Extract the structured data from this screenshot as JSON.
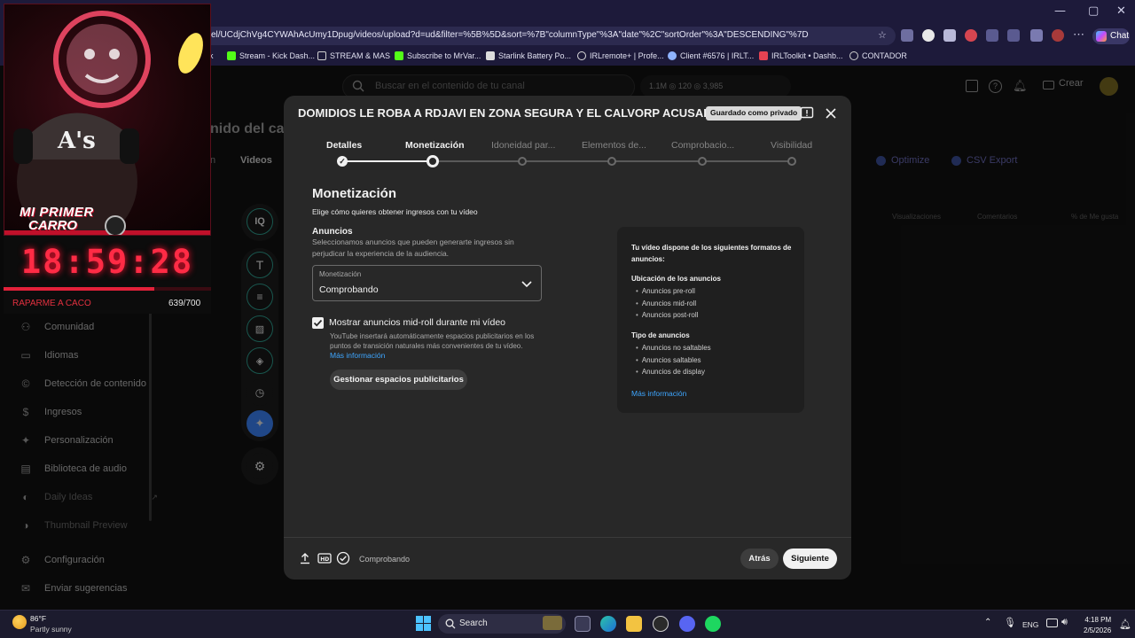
{
  "browser": {
    "url": "el/UCdjChVg4CYWAhAcUmy1Dpug/videos/upload?d=ud&filter=%5B%5D&sort=%7B\"columnType\"%3A\"date\"%2C\"sortOrder\"%3A\"DESCENDING\"%7D",
    "chat_label": "Chat",
    "window_controls": [
      "—",
      "▢",
      "✕"
    ],
    "bookmarks": [
      {
        "label": "k",
        "color": "#53fc18"
      },
      {
        "label": "Stream - Kick Dash...",
        "color": "#53fc18"
      },
      {
        "label": "STREAM & MAS",
        "color": "#cfcfcf"
      },
      {
        "label": "Subscribe to MrVar...",
        "color": "#53fc18"
      },
      {
        "label": "Starlink Battery Po...",
        "color": "#dcdcdc"
      },
      {
        "label": "IRLremote+ | Profe...",
        "color": "#dcdcdc"
      },
      {
        "label": "Client #6576 | IRLT...",
        "color": "#8fb3ff"
      },
      {
        "label": "IRLToolkit • Dashb...",
        "color": "#e34252"
      },
      {
        "label": "CONTADOR",
        "color": "#cfcfcf"
      }
    ]
  },
  "studio": {
    "search_placeholder": "Buscar en el contenido de tu canal",
    "stats": "1.1M  ◎ 120  ◎ 3,985",
    "create_label": "Crear",
    "page_title": "nido del can",
    "tabs": [
      "n",
      "Videos"
    ],
    "right_actions": [
      "Optimize",
      "CSV Export"
    ],
    "columns": [
      "Visualizaciones",
      "Comentarios",
      "% de Me gusta"
    ],
    "sidebar": [
      {
        "label": "Comunidad",
        "icon": "people-icon",
        "glyph": "⚇",
        "dim": false
      },
      {
        "label": "Idiomas",
        "icon": "subtitles-icon",
        "glyph": "▭",
        "dim": false
      },
      {
        "label": "Detección de contenido",
        "icon": "copyright-icon",
        "glyph": "©",
        "dim": false
      },
      {
        "label": "Ingresos",
        "icon": "dollar-icon",
        "glyph": "$",
        "dim": false
      },
      {
        "label": "Personalización",
        "icon": "magic-wand-icon",
        "glyph": "✦",
        "dim": false
      },
      {
        "label": "Biblioteca de audio",
        "icon": "audio-library-icon",
        "glyph": "▤",
        "dim": false
      },
      {
        "label": "Daily Ideas",
        "icon": "ideas-icon",
        "glyph": "◐",
        "dim": true
      },
      {
        "label": "Thumbnail Preview",
        "icon": "preview-icon",
        "glyph": "◑",
        "dim": true
      },
      {
        "label": "Configuración",
        "icon": "gear-icon",
        "glyph": "⚙",
        "dim": false
      },
      {
        "label": "Enviar sugerencias",
        "icon": "feedback-icon",
        "glyph": "✉",
        "dim": false
      }
    ]
  },
  "webcam": {
    "title_line1": "MI PRIMER",
    "title_line2": "CARRO",
    "clock": "18:59:28",
    "goal_label": "RAPARME A CACO",
    "goal_count": "639/700",
    "goal_progress": 0.913
  },
  "modal": {
    "title": "DOMIDIOS LE ROBA A RDJAVI EN ZONA SEGURA Y EL CALVORP ACUSAD...",
    "saved_badge": "Guardado como privado",
    "steps": [
      {
        "label": "Detalles",
        "state": "done"
      },
      {
        "label": "Monetización",
        "state": "current"
      },
      {
        "label": "Idoneidad par...",
        "state": "pending"
      },
      {
        "label": "Elementos de...",
        "state": "pending"
      },
      {
        "label": "Comprobacio...",
        "state": "pending"
      },
      {
        "label": "Visibilidad",
        "state": "pending"
      }
    ],
    "heading": "Monetización",
    "subheading": "Elige cómo quieres obtener ingresos con tu vídeo",
    "ads_heading": "Anuncios",
    "ads_description": "Seleccionamos anuncios que pueden generarte ingresos sin perjudicar la experiencia de la audiencia.",
    "select_label": "Monetización",
    "select_value": "Comprobando",
    "midroll_checked": true,
    "midroll_label": "Mostrar anuncios mid-roll durante mi vídeo",
    "midroll_description": "YouTube insertará automáticamente espacios publicitarios en los puntos de transición naturales más convenientes de tu vídeo.",
    "more_info": "Más información",
    "manage_button": "Gestionar espacios publicitarios",
    "info_card": {
      "heading": "Tu vídeo dispone de los siguientes formatos de anuncios:",
      "placement_title": "Ubicación de los anuncios",
      "placements": [
        "Anuncios pre-roll",
        "Anuncios mid-roll",
        "Anuncios post-roll"
      ],
      "types_title": "Tipo de anuncios",
      "types": [
        "Anuncios no saltables",
        "Anuncios saltables",
        "Anuncios de display"
      ],
      "more_info": "Más información"
    },
    "footer_status": "Comprobando",
    "back_button": "Atrás",
    "next_button": "Siguiente"
  },
  "taskbar": {
    "temperature": "86°F",
    "weather": "Partly sunny",
    "search": "Search",
    "language": "ENG",
    "time": "4:18 PM",
    "date": "2/5/2026"
  },
  "colors": {
    "accent_blue": "#3ea6ff",
    "rail_ring": "#2e9e8f",
    "ai_button": "#3b82f6",
    "clock_red": "#ff2b45"
  }
}
